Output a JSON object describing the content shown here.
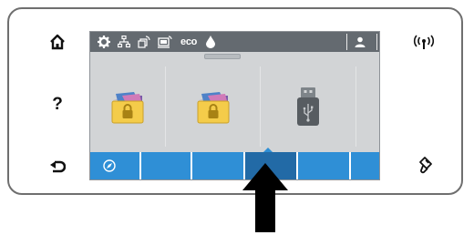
{
  "side_buttons": {
    "home": "home-icon",
    "help": "?",
    "back": "back-icon",
    "wireless": "wireless-icon",
    "nfc": "nfc-touch-icon"
  },
  "status_bar": {
    "eco_label": "eco",
    "icons": [
      "settings-icon",
      "network-icon",
      "wifi-direct-icon",
      "web-services-icon",
      "eco-icon",
      "ink-drop-icon",
      "user-icon"
    ]
  },
  "tiles": [
    {
      "name": "secure-folder-1",
      "icon": "locked-folder-icon"
    },
    {
      "name": "secure-folder-2",
      "icon": "locked-folder-icon"
    },
    {
      "name": "usb-drive",
      "icon": "usb-drive-icon"
    },
    {
      "name": "empty-tile",
      "icon": ""
    }
  ],
  "nav_bar": {
    "segments": 6,
    "selected_index": 3,
    "first_icon": "compass-icon"
  },
  "colors": {
    "status_bar": "#646a70",
    "screen": "#d2d4d6",
    "nav_bar": "#2f8fd6",
    "nav_selected": "#226aa6",
    "folder": "#f4cc4a",
    "usb": "#575c61"
  }
}
